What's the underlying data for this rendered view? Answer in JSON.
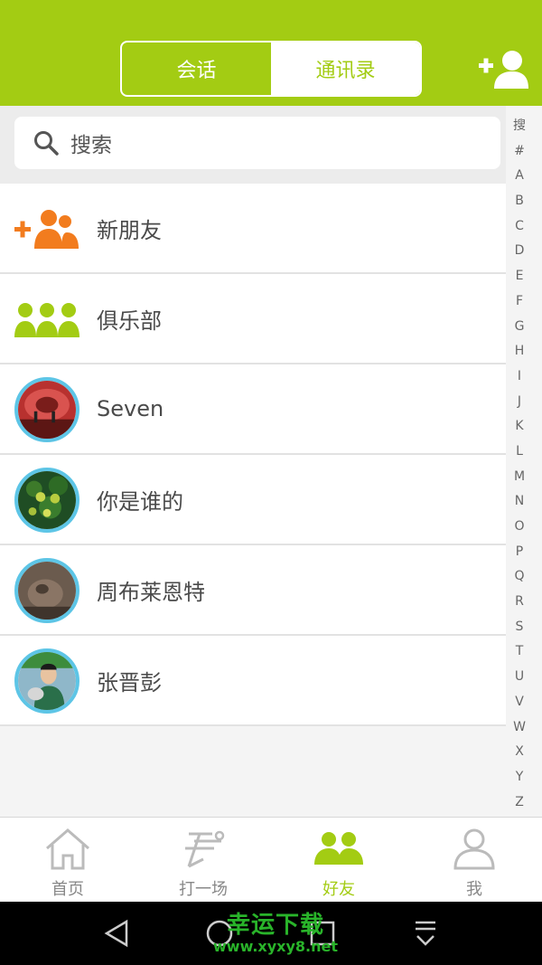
{
  "header": {
    "tabs": [
      {
        "label": "会话",
        "active": false
      },
      {
        "label": "通讯录",
        "active": true
      }
    ],
    "add_icon": "add-friend-icon",
    "accent_color": "#a3cc13"
  },
  "search": {
    "placeholder": "搜索"
  },
  "contacts": [
    {
      "name": "新朋友",
      "icon": "new-friends-icon"
    },
    {
      "name": "俱乐部",
      "icon": "club-icon"
    },
    {
      "name": "Seven",
      "icon": "avatar"
    },
    {
      "name": "你是谁的",
      "icon": "avatar"
    },
    {
      "name": "周布莱恩特",
      "icon": "avatar"
    },
    {
      "name": "张晋彭",
      "icon": "avatar"
    }
  ],
  "index_letters": [
    "搜",
    "#",
    "A",
    "B",
    "C",
    "D",
    "E",
    "F",
    "G",
    "H",
    "I",
    "J",
    "K",
    "L",
    "M",
    "N",
    "O",
    "P",
    "Q",
    "R",
    "S",
    "T",
    "U",
    "V",
    "W",
    "X",
    "Y",
    "Z"
  ],
  "tabbar": [
    {
      "label": "首页",
      "icon": "home-icon",
      "active": false
    },
    {
      "label": "打一场",
      "icon": "play-icon",
      "active": false
    },
    {
      "label": "好友",
      "icon": "friends-icon",
      "active": true
    },
    {
      "label": "我",
      "icon": "profile-icon",
      "active": false
    }
  ],
  "watermark": {
    "line1": "幸运下载",
    "line2": "www.xyxy8.net"
  }
}
